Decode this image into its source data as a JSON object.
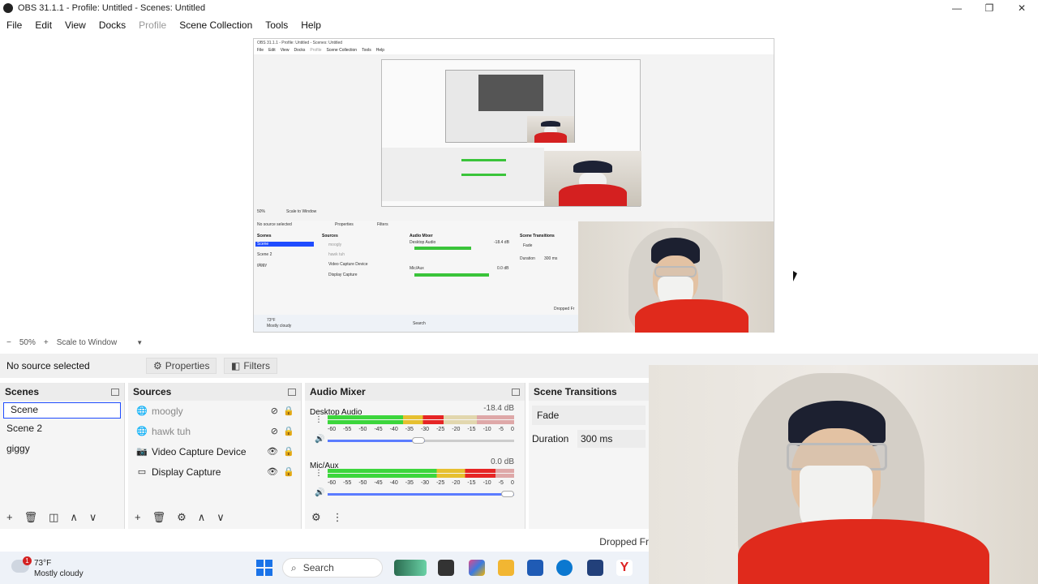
{
  "window": {
    "title": "OBS 31.1.1 - Profile: Untitled - Scenes: Untitled",
    "minimize": "—",
    "maximize": "❐",
    "close": "✕"
  },
  "menu": {
    "items": [
      "File",
      "Edit",
      "View",
      "Docks",
      "Profile",
      "Scene Collection",
      "Tools",
      "Help"
    ],
    "disabled": [
      "Profile"
    ]
  },
  "preview_zoom": {
    "minus": "−",
    "zoom": "50%",
    "plus": "+",
    "scale_mode": "Scale to Window",
    "dropdown_icon": "▼"
  },
  "context_bar": {
    "label": "No source selected",
    "properties": "Properties",
    "filters": "Filters"
  },
  "scenes": {
    "title": "Scenes",
    "items": [
      "Scene",
      "Scene 2",
      "giggy"
    ],
    "selected": "Scene"
  },
  "sources": {
    "title": "Sources",
    "items": [
      {
        "name": "moogly",
        "icon": "browser-icon",
        "visible": false
      },
      {
        "name": "hawk tuh",
        "icon": "browser-icon",
        "visible": false
      },
      {
        "name": "Video Capture Device",
        "icon": "camera-icon",
        "visible": true
      },
      {
        "name": "Display Capture",
        "icon": "monitor-icon",
        "visible": true
      }
    ]
  },
  "audio_mixer": {
    "title": "Audio Mixer",
    "ticks": [
      "-60",
      "-55",
      "-50",
      "-45",
      "-40",
      "-35",
      "-30",
      "-25",
      "-20",
      "-15",
      "-10",
      "-5",
      "0"
    ],
    "channels": [
      {
        "name": "Desktop Audio",
        "db": "-18.4 dB",
        "level": 0.62,
        "volume": 0.52
      },
      {
        "name": "Mic/Aux",
        "db": "0.0 dB",
        "level": 0.9,
        "volume": 1.0
      }
    ]
  },
  "scene_transitions": {
    "title": "Scene Transitions",
    "transition": "Fade",
    "duration_label": "Duration",
    "duration_value": "300 ms"
  },
  "status": {
    "dropped_frames": "Dropped Fr"
  },
  "taskbar": {
    "weather_badge": "1",
    "temperature": "73°F",
    "condition": "Mostly cloudy",
    "search_placeholder": "Search"
  },
  "nested_preview": {
    "title": "OBS 31.1.1 - Profile: Untitled - Scenes: Untitled",
    "menu": [
      "File",
      "Edit",
      "View",
      "Docks",
      "Profile",
      "Scene Collection",
      "Tools",
      "Help"
    ],
    "no_source": "No source selected",
    "properties": "Properties",
    "filters": "Filters",
    "zoom": "50%",
    "scale_mode": "Scale to Window",
    "scenes_title": "Scenes",
    "scenes": [
      "Scene",
      "Scene 2",
      "giggy"
    ],
    "sources_title": "Sources",
    "sources": [
      "moogly",
      "hawk tuh",
      "Video Capture Device",
      "Display Capture"
    ],
    "mixer_title": "Audio Mixer",
    "desktop_audio": "Desktop Audio",
    "desktop_db": "-18.4 dB",
    "mic": "Mic/Aux",
    "mic_db": "0.0 dB",
    "transitions_title": "Scene Transitions",
    "fade": "Fade",
    "duration": "Duration",
    "duration_value": "300 ms",
    "dropped": "Dropped Fr",
    "temp": "73°F",
    "condition": "Mostly cloudy",
    "search": "Search"
  },
  "colors": {
    "selection_border": "#1f4cff",
    "meter_green": "#3cd63c",
    "meter_yellow": "#e6c030",
    "meter_red": "#e62525",
    "slider_blue": "#5b7cff"
  }
}
